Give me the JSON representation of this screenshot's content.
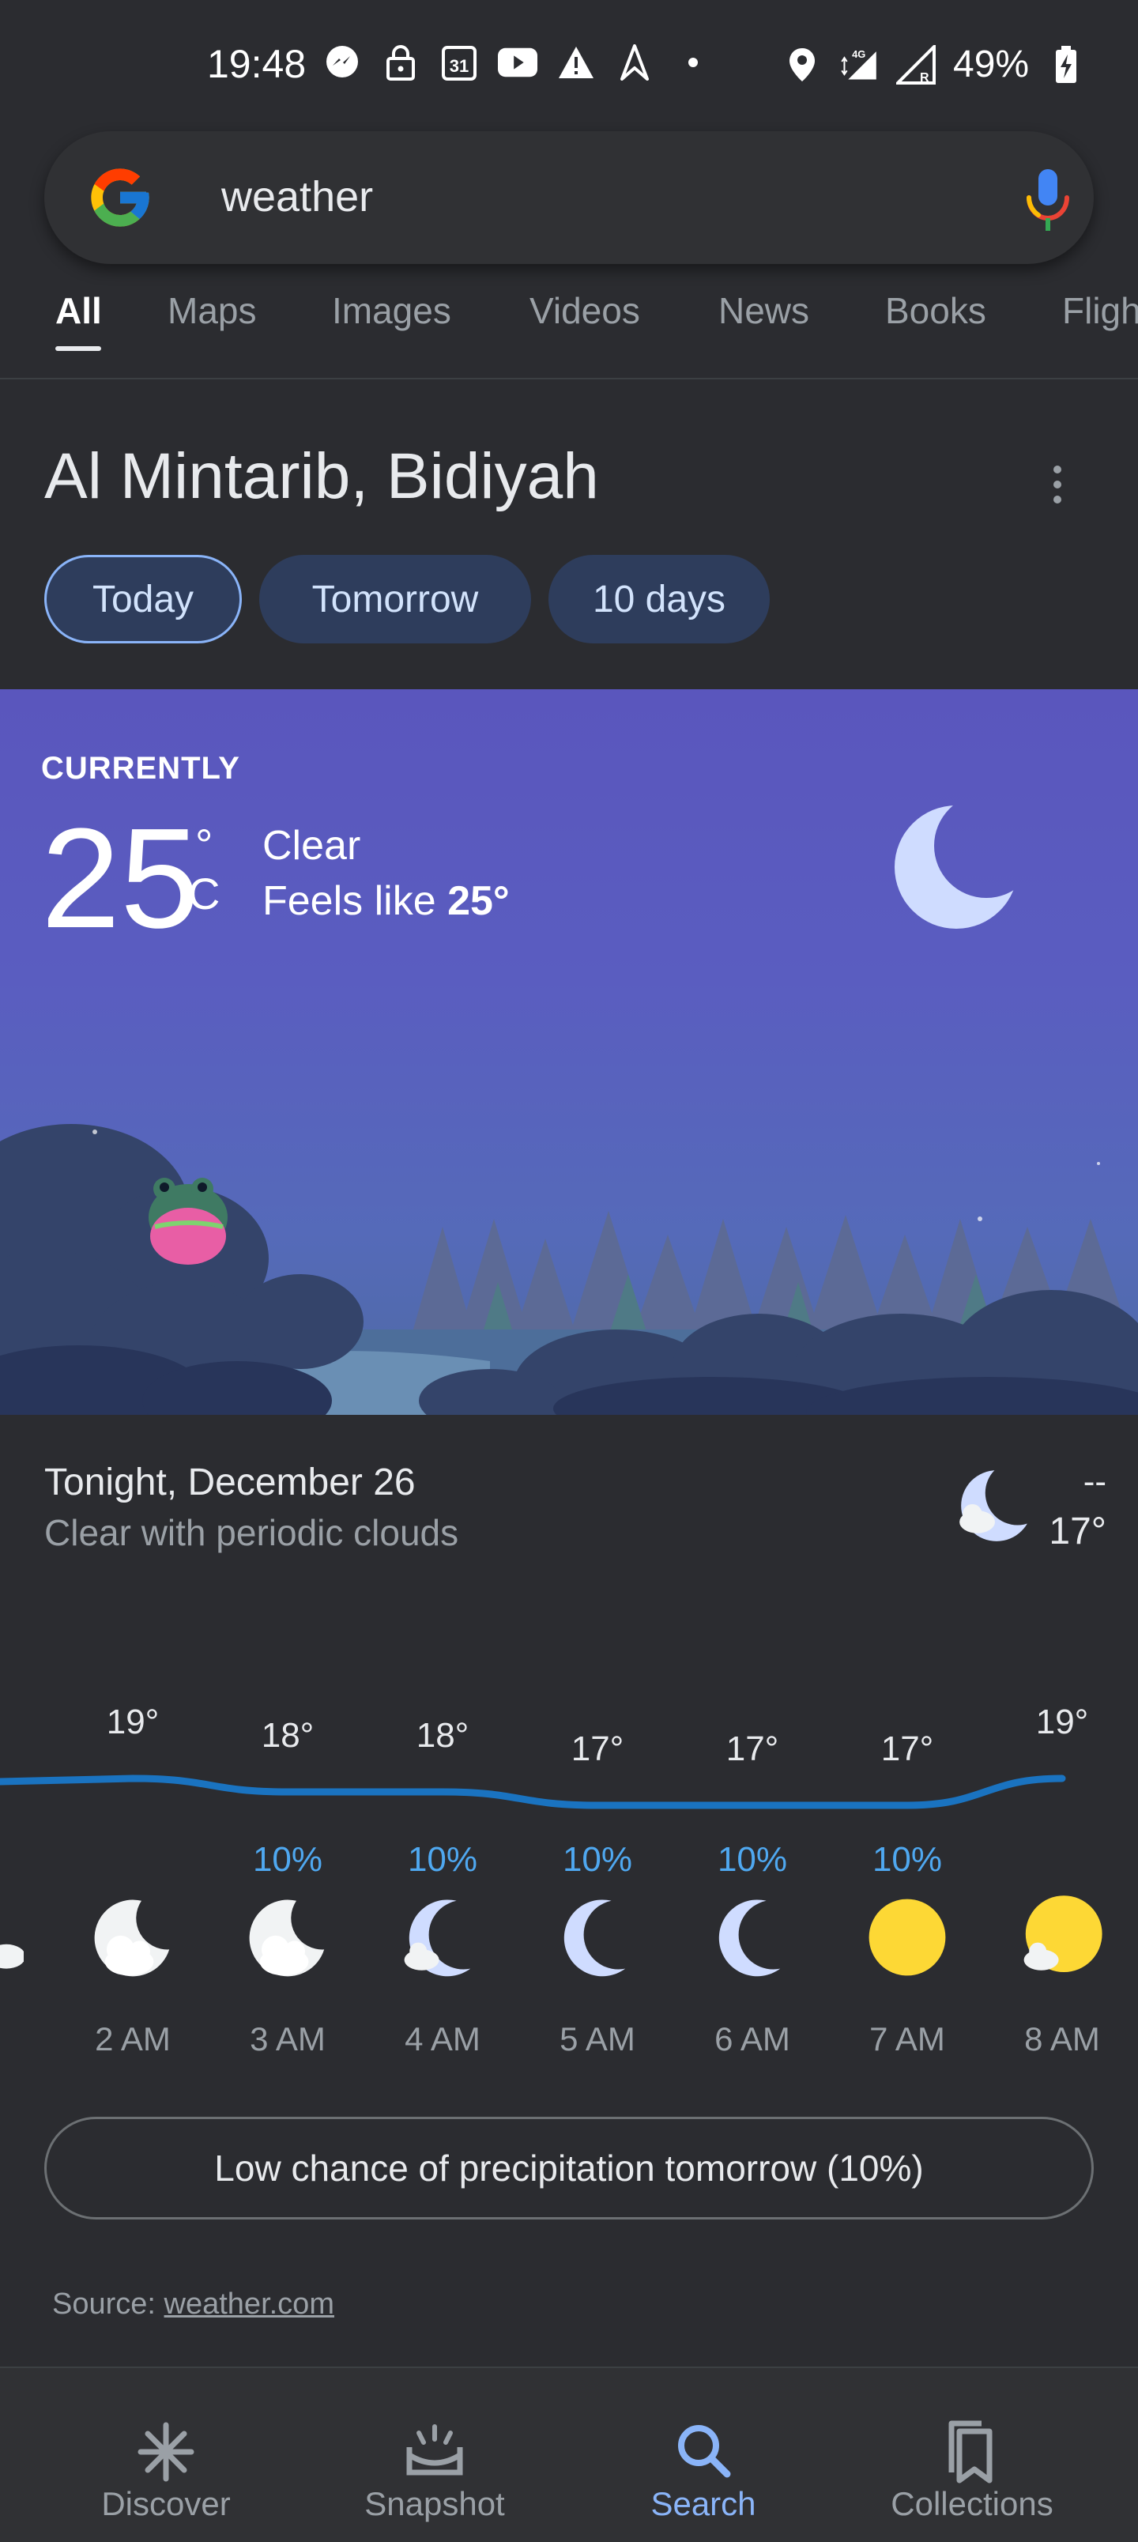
{
  "status_bar": {
    "time": "19:48",
    "battery": "49%",
    "left_icons": [
      "messenger-icon",
      "lock-icon",
      "calendar-icon",
      "youtube-icon",
      "alert-icon",
      "arrow-icon",
      "dot-icon"
    ],
    "right_icons": [
      "location-icon",
      "signal-4g-icon",
      "signal-r-icon",
      "battery-charging-icon"
    ]
  },
  "search": {
    "query": "weather"
  },
  "tabs": [
    {
      "label": "All",
      "active": true
    },
    {
      "label": "Maps"
    },
    {
      "label": "Images"
    },
    {
      "label": "Videos"
    },
    {
      "label": "News"
    },
    {
      "label": "Books"
    },
    {
      "label": "Fligh"
    }
  ],
  "weather": {
    "location": "Al Mintarib, Bidiyah",
    "chips": [
      {
        "label": "Today",
        "selected": true
      },
      {
        "label": "Tomorrow"
      },
      {
        "label": "10 days"
      }
    ],
    "current": {
      "label": "CURRENTLY",
      "temp": "25",
      "unit_degree": "°",
      "unit_letter": "C",
      "condition": "Clear",
      "feels_like_prefix": "Feels like",
      "feels_like_value": "25°"
    },
    "tonight": {
      "title": "Tonight, December 26",
      "description": "Clear with periodic clouds",
      "high": "--",
      "low": "17°"
    },
    "hourly": [
      {
        "time": "2 AM",
        "temp": "19°",
        "temp_value": 19,
        "precip": "",
        "icon": "moon-cloud-icon"
      },
      {
        "time": "3 AM",
        "temp": "18°",
        "temp_value": 18,
        "precip": "10%",
        "icon": "moon-cloud-icon"
      },
      {
        "time": "4 AM",
        "temp": "18°",
        "temp_value": 18,
        "precip": "10%",
        "icon": "crescent-cloud-icon"
      },
      {
        "time": "5 AM",
        "temp": "17°",
        "temp_value": 17,
        "precip": "10%",
        "icon": "crescent-moon-icon"
      },
      {
        "time": "6 AM",
        "temp": "17°",
        "temp_value": 17,
        "precip": "10%",
        "icon": "crescent-moon-icon"
      },
      {
        "time": "7 AM",
        "temp": "17°",
        "temp_value": 17,
        "precip": "10%",
        "icon": "sun-icon"
      },
      {
        "time": "8 AM",
        "temp": "19°",
        "temp_value": 19,
        "precip": "",
        "icon": "sun-cloud-icon"
      }
    ],
    "precip_note": "Low chance of precipitation tomorrow (10%)",
    "source_prefix": "Source:",
    "source_link": "weather.com"
  },
  "bottom_nav": [
    {
      "label": "Discover",
      "icon": "asterisk-icon"
    },
    {
      "label": "Snapshot",
      "icon": "snapshot-icon"
    },
    {
      "label": "Search",
      "icon": "search-icon",
      "active": true
    },
    {
      "label": "Collections",
      "icon": "collections-icon"
    }
  ],
  "colors": {
    "background": "#2b2c30",
    "accent": "#8ab4f8",
    "precip": "#4fa8f0",
    "temp_line": "#1a73c0"
  }
}
